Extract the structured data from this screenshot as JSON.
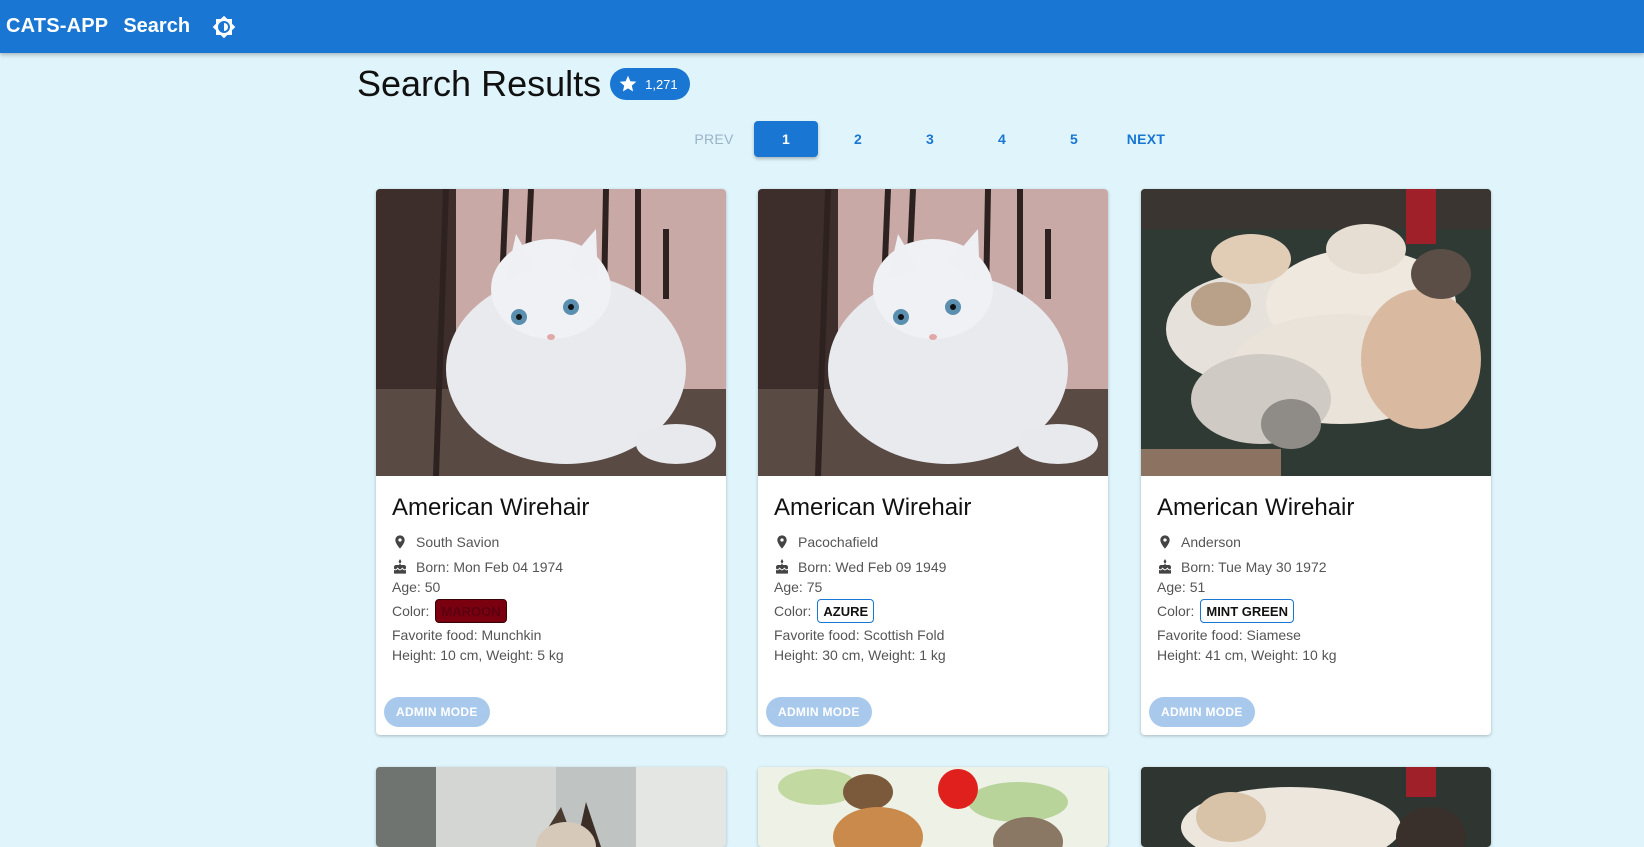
{
  "appbar": {
    "brand": "CATS-APP",
    "search_link": "Search",
    "theme_icon": "brightness-icon"
  },
  "header": {
    "title": "Search Results",
    "count": "1,271",
    "count_icon": "star-icon"
  },
  "pagination": {
    "prev": "PREV",
    "pages": [
      "1",
      "2",
      "3",
      "4",
      "5"
    ],
    "active_page": "1",
    "next": "NEXT"
  },
  "cards": [
    {
      "breed": "American Wirehair",
      "location": "South Savion",
      "born": "Born: Mon Feb 04 1974",
      "age": "Age: 50",
      "color_label": "Color:",
      "color": "MAROON",
      "color_hex": "#7a0010",
      "food": "Favorite food: Munchkin",
      "size": "Height: 10 cm, Weight: 5 kg",
      "admin": "ADMIN MODE"
    },
    {
      "breed": "American Wirehair",
      "location": "Pacochafield",
      "born": "Born: Wed Feb 09 1949",
      "age": "Age: 75",
      "color_label": "Color:",
      "color": "AZURE",
      "color_hex": "#f0ffff",
      "food": "Favorite food: Scottish Fold",
      "size": "Height: 30 cm, Weight: 1 kg",
      "admin": "ADMIN MODE"
    },
    {
      "breed": "American Wirehair",
      "location": "Anderson",
      "born": "Born: Tue May 30 1972",
      "age": "Age: 51",
      "color_label": "Color:",
      "color": "MINT GREEN",
      "color_hex": "#ffffff",
      "food": "Favorite food: Siamese",
      "size": "Height: 41 cm, Weight: 10 kg",
      "admin": "ADMIN MODE"
    }
  ],
  "colors": {
    "primary": "#1976d2",
    "background": "#dff5fb",
    "admin_button": "#a9c9ec"
  }
}
